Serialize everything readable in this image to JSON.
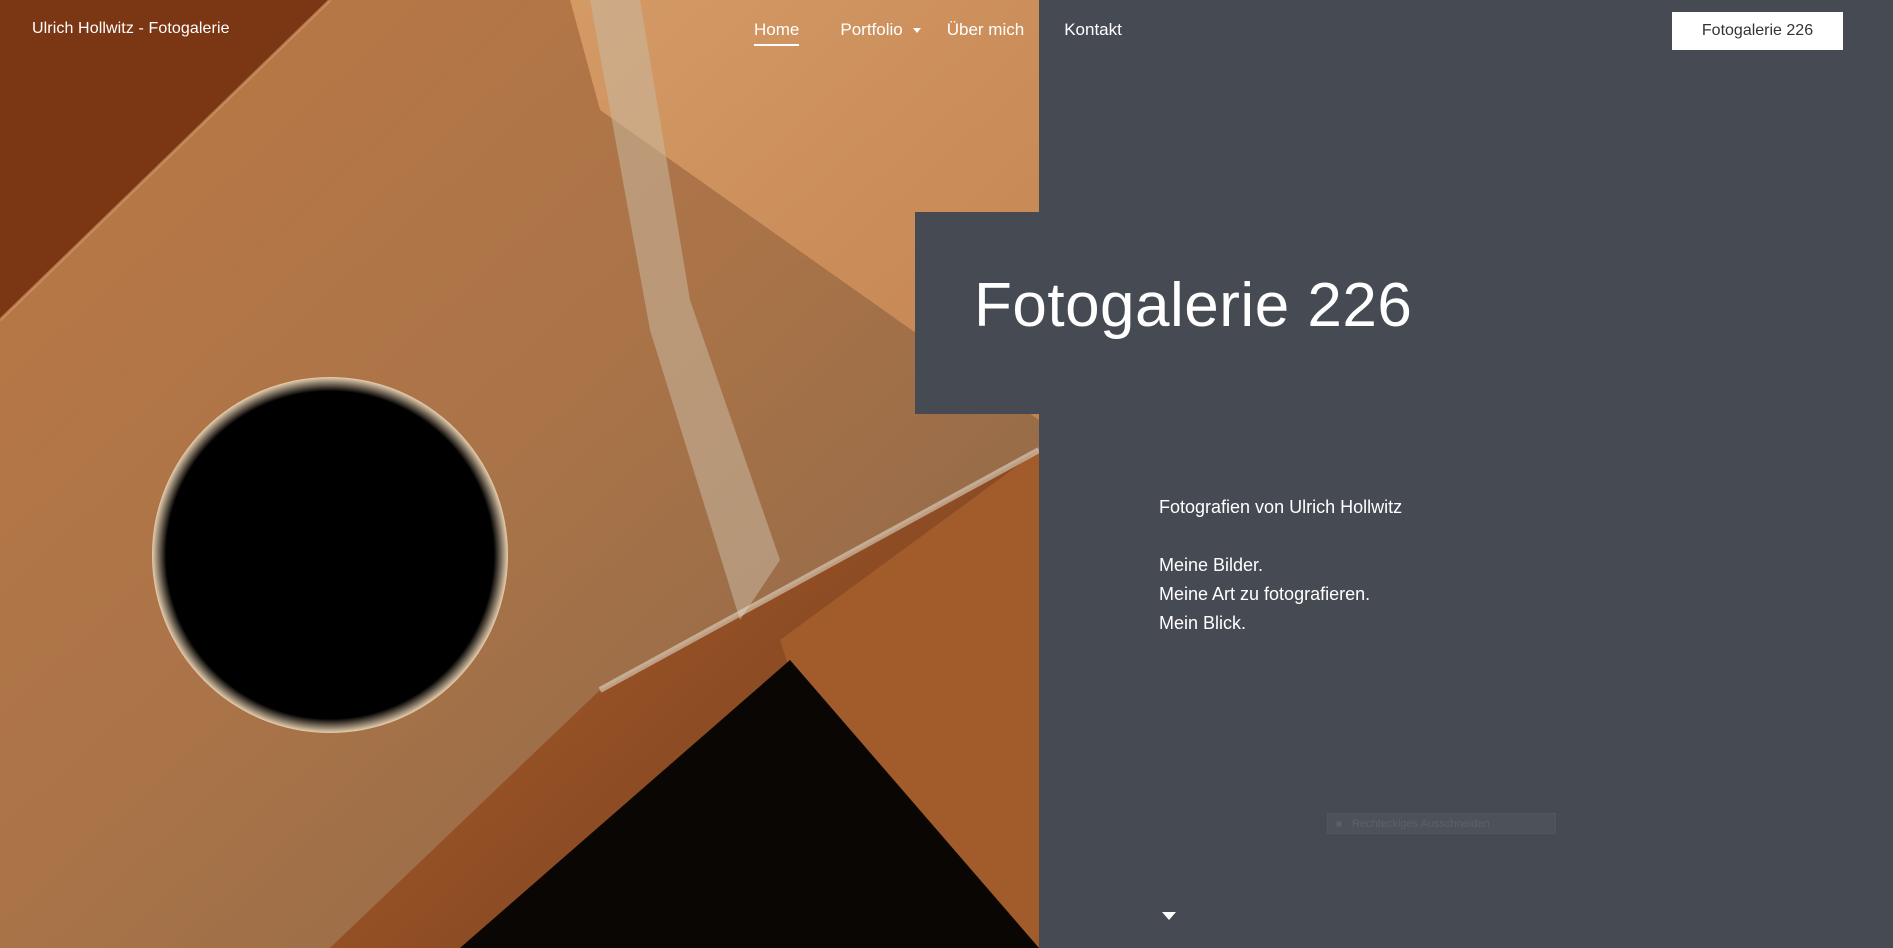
{
  "header": {
    "site_title": "Ulrich Hollwitz - Fotogalerie",
    "nav": [
      {
        "label": "Home",
        "active": true
      },
      {
        "label": "Portfolio",
        "has_dropdown": true
      },
      {
        "label": "Über mich"
      },
      {
        "label": "Kontakt"
      }
    ],
    "cta_label": "Fotogalerie 226"
  },
  "hero": {
    "heading": "Fotogalerie 226",
    "intro_line": "Fotografien von Ulrich Hollwitz",
    "lines": [
      "Meine Bilder.",
      "Meine Art zu fotografieren.",
      "Mein Blick."
    ]
  },
  "overlay": {
    "ghost_tooltip": "Rechteckiges Ausschneiden"
  },
  "colors": {
    "panel": "#464a53",
    "rust": "#9a4f22",
    "button_bg": "#ffffff"
  },
  "icons": {
    "scroll_down": "caret-down-icon",
    "dropdown": "chevron-down-icon"
  }
}
